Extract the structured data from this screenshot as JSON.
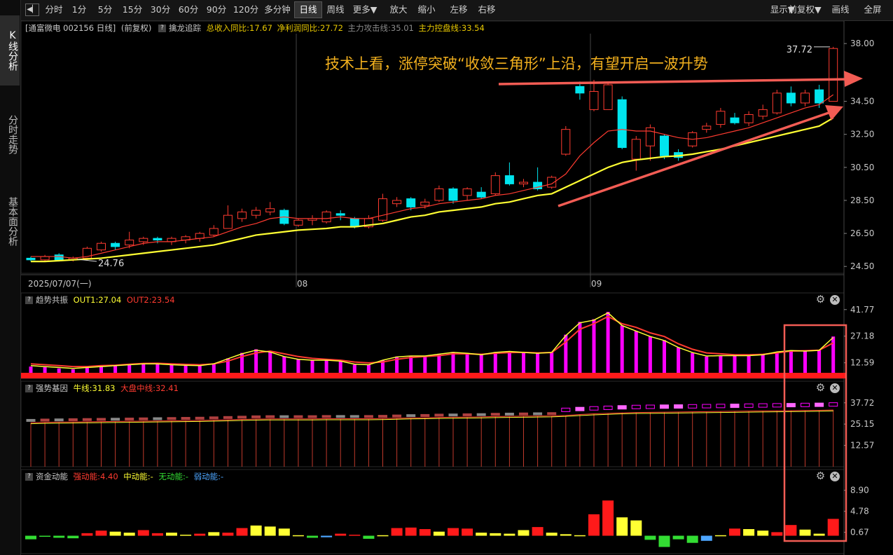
{
  "sidebar": {
    "tabs": [
      {
        "label": "K线分析",
        "active": true
      },
      {
        "label": "分时走势",
        "active": false
      },
      {
        "label": "基本面分析",
        "active": false
      }
    ]
  },
  "toolbar": {
    "back_icon": "back-arrow-icon",
    "left_buttons": [
      "分时",
      "1分",
      "5分",
      "15分",
      "30分",
      "60分",
      "90分",
      "120分",
      "多分钟",
      "日线",
      "周线",
      "更多▼",
      "放大",
      "缩小",
      "左移",
      "右移"
    ],
    "active": "日线",
    "right_buttons": [
      "显示▼",
      "前复权▼",
      "画线",
      "全屏"
    ]
  },
  "main_info": {
    "stock": "[通富微电 002156 日线]",
    "adjust": "(前复权)",
    "indicator": "擒龙追踪",
    "items": [
      {
        "text": "总收入同比:17.67",
        "color": "#e8c800"
      },
      {
        "text": "净利润同比:27.72",
        "color": "#e8c800"
      },
      {
        "text": "主力攻击线:35.01",
        "color": "#8a8a8a"
      },
      {
        "text": "主力控盘线:33.54",
        "color": "#e8c800"
      }
    ]
  },
  "annotation": {
    "text": "技术上看，涨停突破“收敛三角形”上沿，有望开启一波升势",
    "high_label": "37.72",
    "low_label": "24.76"
  },
  "dates": {
    "start": "2025/07/07(一)",
    "m8": "08",
    "m9": "09"
  },
  "colors": {
    "up": "#ff3b30",
    "down": "#00e5ee",
    "ma_fast": "#ff3b30",
    "ma_slow": "#ffff33",
    "magenta": "#ff00ff",
    "arrow": "#f25c54"
  },
  "chart_data": [
    {
      "type": "candlestick",
      "name": "擒龙追踪",
      "ylim": [
        24.0,
        38.6
      ],
      "y_ticks": [
        "38.00",
        "34.50",
        "32.50",
        "30.50",
        "28.50",
        "26.50",
        "24.50"
      ],
      "candles": [
        [
          25.0,
          24.9,
          25.1,
          24.8
        ],
        [
          24.9,
          25.1,
          25.2,
          24.8
        ],
        [
          25.2,
          24.9,
          25.3,
          24.8
        ],
        [
          24.9,
          25.0,
          25.1,
          24.8
        ],
        [
          25.0,
          25.6,
          25.7,
          24.9
        ],
        [
          25.5,
          25.9,
          26.0,
          25.4
        ],
        [
          25.9,
          25.7,
          26.0,
          25.5
        ],
        [
          25.8,
          26.1,
          26.6,
          25.6
        ],
        [
          26.0,
          26.2,
          26.3,
          25.8
        ],
        [
          26.2,
          26.1,
          26.3,
          25.9
        ],
        [
          26.0,
          26.2,
          26.3,
          25.8
        ],
        [
          26.1,
          26.3,
          26.4,
          25.9
        ],
        [
          26.2,
          26.5,
          26.6,
          26.0
        ],
        [
          26.4,
          26.8,
          27.0,
          26.3
        ],
        [
          26.8,
          27.6,
          28.2,
          26.8
        ],
        [
          27.4,
          27.8,
          28.0,
          27.2
        ],
        [
          27.6,
          27.9,
          28.1,
          27.4
        ],
        [
          27.8,
          28.0,
          28.4,
          27.6
        ],
        [
          27.9,
          27.1,
          28.0,
          27.0
        ],
        [
          27.0,
          27.3,
          27.4,
          26.9
        ],
        [
          27.3,
          27.4,
          27.6,
          27.0
        ],
        [
          27.2,
          27.8,
          27.9,
          27.1
        ],
        [
          27.7,
          27.6,
          27.9,
          27.3
        ],
        [
          27.4,
          26.9,
          27.5,
          26.8
        ],
        [
          26.9,
          27.4,
          27.6,
          26.8
        ],
        [
          27.3,
          28.6,
          28.9,
          27.2
        ],
        [
          28.3,
          28.5,
          28.7,
          28.1
        ],
        [
          28.6,
          28.1,
          28.7,
          27.9
        ],
        [
          28.2,
          28.4,
          28.6,
          28.0
        ],
        [
          28.5,
          29.2,
          29.4,
          28.4
        ],
        [
          29.2,
          28.5,
          29.3,
          28.3
        ],
        [
          28.8,
          29.2,
          29.3,
          28.5
        ],
        [
          29.0,
          28.7,
          29.3,
          28.6
        ],
        [
          28.9,
          30.0,
          30.2,
          28.8
        ],
        [
          30.0,
          29.5,
          30.8,
          29.4
        ],
        [
          29.5,
          29.6,
          29.8,
          29.3
        ],
        [
          29.6,
          29.2,
          30.5,
          29.1
        ],
        [
          29.3,
          29.9,
          30.0,
          29.2
        ],
        [
          31.3,
          32.8,
          33.0,
          31.2
        ],
        [
          35.4,
          35.0,
          35.7,
          34.6
        ],
        [
          34.0,
          35.1,
          35.8,
          33.9
        ],
        [
          34.0,
          35.5,
          35.7,
          34.0
        ],
        [
          34.6,
          31.7,
          34.8,
          31.6
        ],
        [
          31.0,
          32.2,
          32.4,
          30.3
        ],
        [
          31.8,
          32.9,
          33.1,
          30.9
        ],
        [
          32.4,
          31.2,
          32.5,
          31.0
        ],
        [
          31.4,
          31.1,
          31.6,
          30.9
        ],
        [
          31.8,
          32.6,
          32.7,
          31.7
        ],
        [
          32.8,
          33.0,
          33.2,
          32.6
        ],
        [
          33.1,
          33.9,
          34.1,
          32.9
        ],
        [
          33.5,
          33.2,
          33.8,
          33.1
        ],
        [
          33.2,
          33.7,
          33.9,
          33.0
        ],
        [
          33.6,
          34.0,
          34.3,
          33.4
        ],
        [
          33.8,
          35.0,
          35.2,
          33.7
        ],
        [
          35.0,
          34.4,
          35.4,
          34.2
        ],
        [
          34.4,
          35.0,
          35.2,
          34.2
        ],
        [
          35.2,
          34.4,
          35.5,
          34.1
        ],
        [
          34.5,
          37.7,
          37.8,
          34.5
        ]
      ],
      "ma_fast": [
        25.1,
        25.1,
        25.1,
        25.0,
        25.1,
        25.3,
        25.5,
        25.7,
        25.9,
        26.0,
        26.0,
        26.1,
        26.2,
        26.3,
        26.6,
        26.9,
        27.1,
        27.4,
        27.5,
        27.4,
        27.4,
        27.4,
        27.5,
        27.4,
        27.4,
        27.6,
        27.8,
        28.0,
        28.1,
        28.3,
        28.4,
        28.5,
        28.6,
        28.8,
        28.9,
        29.1,
        29.3,
        29.5,
        30.1,
        31.2,
        32.0,
        32.7,
        32.8,
        32.7,
        32.7,
        32.5,
        32.3,
        32.2,
        32.3,
        32.5,
        32.7,
        32.9,
        33.2,
        33.5,
        33.8,
        34.1,
        34.3,
        34.9
      ],
      "ma_slow": [
        24.8,
        24.8,
        24.85,
        24.9,
        24.95,
        25.0,
        25.1,
        25.2,
        25.3,
        25.4,
        25.5,
        25.6,
        25.7,
        25.8,
        26.0,
        26.2,
        26.4,
        26.5,
        26.6,
        26.7,
        26.75,
        26.8,
        26.9,
        26.9,
        27.0,
        27.1,
        27.3,
        27.5,
        27.6,
        27.8,
        27.9,
        28.0,
        28.1,
        28.3,
        28.4,
        28.6,
        28.8,
        28.9,
        29.3,
        29.7,
        30.1,
        30.5,
        30.8,
        30.95,
        31.05,
        31.15,
        31.2,
        31.3,
        31.45,
        31.6,
        31.8,
        32.0,
        32.2,
        32.4,
        32.6,
        32.8,
        33.0,
        33.5
      ]
    },
    {
      "type": "bar+line",
      "name": "趋势共振",
      "legend": [
        {
          "label": "OUT1:27.04",
          "color": "#ffff33"
        },
        {
          "label": "OUT2:23.54",
          "color": "#ff3b30"
        }
      ],
      "ylim": [
        4,
        44
      ],
      "y_ticks": [
        "41.77",
        "27.18",
        "12.59"
      ],
      "values": [
        10.5,
        10.2,
        9.5,
        9.0,
        9.8,
        10.5,
        11.0,
        11.5,
        12.0,
        12.0,
        11.5,
        11.0,
        11.0,
        12.0,
        15.0,
        18.0,
        20.0,
        19.0,
        16.0,
        14.5,
        14.0,
        14.0,
        13.5,
        11.5,
        11.5,
        14.0,
        16.0,
        16.5,
        16.5,
        17.5,
        18.5,
        18.0,
        17.0,
        18.5,
        19.0,
        18.5,
        18.0,
        18.5,
        28.0,
        35.0,
        36.5,
        40.5,
        33.0,
        30.0,
        27.0,
        25.0,
        21.0,
        18.0,
        16.0,
        16.5,
        16.5,
        16.5,
        17.0,
        18.5,
        19.5,
        19.0,
        19.5,
        27.0
      ],
      "out2": [
        12.0,
        11.5,
        11.0,
        10.5,
        10.5,
        11.0,
        11.2,
        11.8,
        12.2,
        12.3,
        12.0,
        11.7,
        11.5,
        12.0,
        13.5,
        16.0,
        18.0,
        19.0,
        17.5,
        16.0,
        15.0,
        14.5,
        14.0,
        13.0,
        12.5,
        13.0,
        14.5,
        15.5,
        16.0,
        16.5,
        17.5,
        17.5,
        17.2,
        17.8,
        18.2,
        18.3,
        18.0,
        18.2,
        24.0,
        31.0,
        34.0,
        38.0,
        34.0,
        32.0,
        29.0,
        27.0,
        23.0,
        20.0,
        18.0,
        17.5,
        17.0,
        17.0,
        17.2,
        18.0,
        19.0,
        19.2,
        19.5,
        23.5
      ],
      "out1": [
        11.0,
        10.5,
        10.0,
        9.5,
        10.0,
        10.5,
        11.0,
        11.5,
        12.0,
        12.0,
        11.5,
        11.2,
        11.0,
        12.0,
        14.8,
        17.5,
        19.5,
        18.5,
        16.0,
        14.5,
        14.0,
        14.0,
        13.5,
        11.8,
        11.5,
        14.0,
        15.8,
        16.3,
        16.3,
        17.3,
        18.3,
        17.8,
        17.0,
        18.3,
        18.8,
        18.3,
        17.8,
        18.3,
        27.5,
        34.5,
        36.0,
        40.0,
        33.0,
        30.0,
        27.0,
        24.8,
        21.0,
        18.2,
        16.3,
        16.5,
        16.5,
        16.5,
        17.0,
        18.5,
        19.3,
        19.0,
        19.4,
        26.5
      ]
    },
    {
      "type": "bar+candlestick",
      "name": "强势基因",
      "legend": [
        {
          "label": "牛线:31.83",
          "color": "#ffff33"
        },
        {
          "label": "大盘中线:32.41",
          "color": "#ff3b30"
        }
      ],
      "ylim": [
        0,
        43
      ],
      "y_ticks": [
        "37.72",
        "25.15",
        "12.57"
      ],
      "bar_values": [
        26,
        26.2,
        26.3,
        26.4,
        26.5,
        26.6,
        26.7,
        26.8,
        26.9,
        27.0,
        27.1,
        27.2,
        27.3,
        27.5,
        27.7,
        27.9,
        28.1,
        28.2,
        28.2,
        28.2,
        28.2,
        28.3,
        28.3,
        28.3,
        28.3,
        28.4,
        28.6,
        28.8,
        28.9,
        29.1,
        29.2,
        29.3,
        29.4,
        29.6,
        29.7,
        29.8,
        29.9,
        30.0,
        30.3,
        30.8,
        31.2,
        31.5,
        31.8,
        32.0,
        32.1,
        32.2,
        32.3,
        32.4,
        32.5,
        32.6,
        32.7,
        32.8,
        32.9,
        33.0,
        33.1,
        33.2,
        33.3,
        33.5
      ]
    },
    {
      "type": "bar",
      "name": "资金动能",
      "legend": [
        {
          "label": "强动能:4.40",
          "color": "#ff3b30"
        },
        {
          "label": "中动能:-",
          "color": "#ffff33"
        },
        {
          "label": "无动能:-",
          "color": "#33dd33"
        },
        {
          "label": "弱动能:-",
          "color": "#4da6ff"
        }
      ],
      "ylim": [
        -3.5,
        10.5
      ],
      "y_ticks": [
        "8.90",
        "4.78",
        "0.67"
      ],
      "values": [
        -0.7,
        -0.1,
        -0.4,
        -0.5,
        0.5,
        1.0,
        0.8,
        0.6,
        1.1,
        0.5,
        0.6,
        0.2,
        0.4,
        0.7,
        0.6,
        1.5,
        2.0,
        1.8,
        1.4,
        0.1,
        -0.4,
        -0.3,
        0.4,
        0.2,
        -0.6,
        0.1,
        1.5,
        1.6,
        1.3,
        0.8,
        1.5,
        1.4,
        0.6,
        0.5,
        0.4,
        1.1,
        1.7,
        0.6,
        0.3,
        0.1,
        4.2,
        6.9,
        3.6,
        3.0,
        -0.8,
        -2.2,
        -0.7,
        -1.4,
        -1.0,
        0.1,
        1.4,
        1.3,
        1.0,
        0.7,
        2.1,
        1.2,
        0.4,
        3.3
      ],
      "categories": [
        "strong",
        "none",
        "mid",
        "none",
        "strong",
        "strong",
        "mid",
        "mid",
        "strong",
        "strong",
        "mid",
        "mid",
        "strong",
        "mid",
        "strong",
        "strong",
        "mid",
        "mid",
        "mid",
        "mid",
        "none",
        "weak",
        "strong",
        "strong",
        "none",
        "mid",
        "strong",
        "strong",
        "strong",
        "mid",
        "strong",
        "strong",
        "mid",
        "mid",
        "mid",
        "mid",
        "strong",
        "mid",
        "mid",
        "mid",
        "strong",
        "strong",
        "mid",
        "mid",
        "none",
        "none",
        "none",
        "none",
        "weak",
        "mid",
        "strong",
        "mid",
        "mid",
        "strong",
        "strong",
        "mid",
        "mid",
        "strong"
      ]
    }
  ]
}
